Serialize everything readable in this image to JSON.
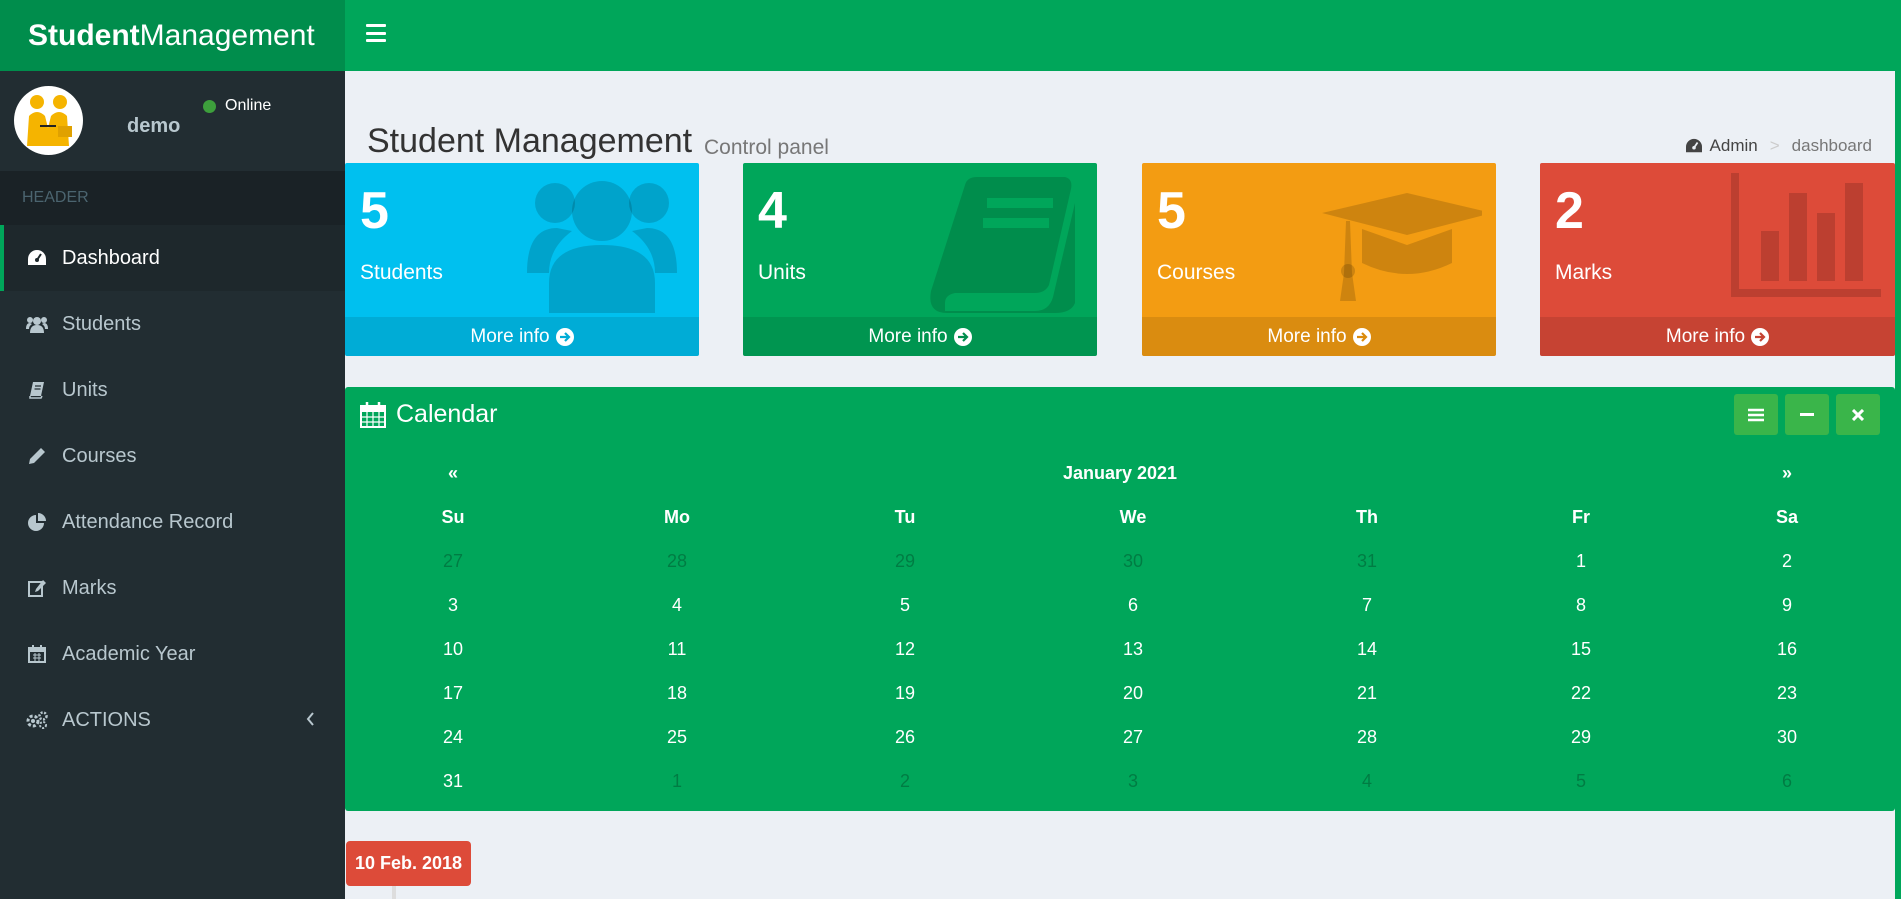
{
  "app": {
    "logo_bold": "Student",
    "logo_rest": "Management"
  },
  "user": {
    "name": "demo",
    "status": "Online"
  },
  "sidebar": {
    "header": "HEADER",
    "items": [
      {
        "label": "Dashboard",
        "icon": "dashboard-icon"
      },
      {
        "label": "Students",
        "icon": "users-icon"
      },
      {
        "label": "Units",
        "icon": "book-icon"
      },
      {
        "label": "Courses",
        "icon": "pencil-icon"
      },
      {
        "label": "Attendance Record",
        "icon": "pie-chart-icon"
      },
      {
        "label": "Marks",
        "icon": "edit-icon"
      },
      {
        "label": "Academic Year",
        "icon": "calendar-icon"
      },
      {
        "label": "ACTIONS",
        "icon": "gears-icon"
      }
    ]
  },
  "page": {
    "title": "Student Management",
    "subtitle": "Control panel",
    "breadcrumb": {
      "root": "Admin",
      "current": "dashboard"
    }
  },
  "boxes": [
    {
      "number": "5",
      "label": "Students",
      "more": "More info",
      "color": "#00c0ef",
      "icon": "users-icon"
    },
    {
      "number": "4",
      "label": "Units",
      "more": "More info",
      "color": "#00a65a",
      "icon": "book-icon"
    },
    {
      "number": "5",
      "label": "Courses",
      "more": "More info",
      "color": "#f39c12",
      "icon": "graduation-cap-icon"
    },
    {
      "number": "2",
      "label": "Marks",
      "more": "More info",
      "color": "#dd4b39",
      "icon": "bar-chart-icon"
    }
  ],
  "calendar": {
    "title": "Calendar",
    "prev": "«",
    "next": "»",
    "month": "January 2021",
    "weekdays": [
      "Su",
      "Mo",
      "Tu",
      "We",
      "Th",
      "Fr",
      "Sa"
    ],
    "weeks": [
      [
        {
          "d": "27",
          "m": true
        },
        {
          "d": "28",
          "m": true
        },
        {
          "d": "29",
          "m": true
        },
        {
          "d": "30",
          "m": true
        },
        {
          "d": "31",
          "m": true
        },
        {
          "d": "1"
        },
        {
          "d": "2"
        }
      ],
      [
        {
          "d": "3"
        },
        {
          "d": "4"
        },
        {
          "d": "5"
        },
        {
          "d": "6"
        },
        {
          "d": "7"
        },
        {
          "d": "8"
        },
        {
          "d": "9"
        }
      ],
      [
        {
          "d": "10"
        },
        {
          "d": "11"
        },
        {
          "d": "12"
        },
        {
          "d": "13"
        },
        {
          "d": "14"
        },
        {
          "d": "15"
        },
        {
          "d": "16"
        }
      ],
      [
        {
          "d": "17"
        },
        {
          "d": "18"
        },
        {
          "d": "19"
        },
        {
          "d": "20"
        },
        {
          "d": "21"
        },
        {
          "d": "22"
        },
        {
          "d": "23"
        }
      ],
      [
        {
          "d": "24"
        },
        {
          "d": "25"
        },
        {
          "d": "26"
        },
        {
          "d": "27"
        },
        {
          "d": "28"
        },
        {
          "d": "29"
        },
        {
          "d": "30"
        }
      ],
      [
        {
          "d": "31"
        },
        {
          "d": "1",
          "m": true
        },
        {
          "d": "2",
          "m": true
        },
        {
          "d": "3",
          "m": true
        },
        {
          "d": "4",
          "m": true
        },
        {
          "d": "5",
          "m": true
        },
        {
          "d": "6",
          "m": true
        }
      ]
    ]
  },
  "timeline": {
    "date": "10 Feb. 2018"
  }
}
